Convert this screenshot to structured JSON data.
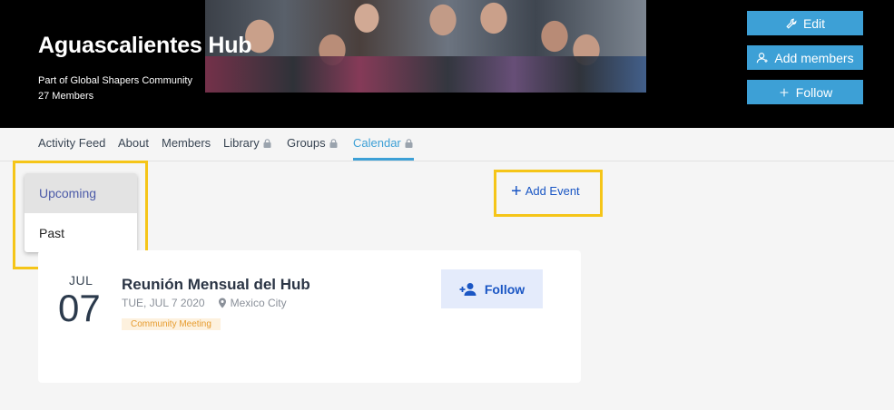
{
  "hub": {
    "title": "Aguascalientes Hub",
    "subtitle": "Part of Global Shapers Community",
    "member_count": "27 Members"
  },
  "actions": {
    "edit_label": "Edit",
    "add_members_label": "Add members",
    "follow_label": "Follow"
  },
  "tabs": [
    {
      "label": "Activity Feed",
      "locked": false
    },
    {
      "label": "About",
      "locked": false
    },
    {
      "label": "Members",
      "locked": false
    },
    {
      "label": "Library",
      "locked": true
    },
    {
      "label": "Groups",
      "locked": true
    },
    {
      "label": "Calendar",
      "locked": true,
      "active": true
    }
  ],
  "filter": {
    "options": [
      "Upcoming",
      "Past"
    ],
    "selected": "Upcoming"
  },
  "add_event_label": "Add Event",
  "event": {
    "month": "JUL",
    "day": "07",
    "title": "Reunión Mensual del Hub",
    "date": "TUE, JUL 7 2020",
    "location": "Mexico City",
    "tag": "Community Meeting",
    "follow_label": "Follow"
  },
  "colors": {
    "accent": "#3da0d6",
    "link": "#1a56c4",
    "highlight": "#f5c518",
    "tag_text": "#e69b2e"
  },
  "icons": {
    "edit": "wrench-icon",
    "add_members": "user-outline-icon",
    "follow": "plus-icon",
    "lock": "lock-icon",
    "location": "map-pin-icon",
    "event_follow": "person-add-icon"
  }
}
